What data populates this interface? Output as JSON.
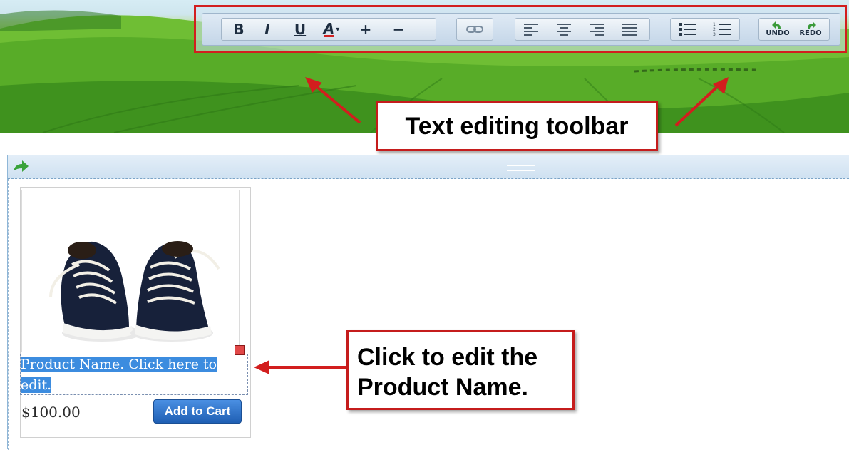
{
  "toolbar": {
    "bold": "B",
    "italic": "I",
    "underline": "U",
    "font_color": "A",
    "font_color_caret": "▾",
    "increase": "+",
    "decrease": "−",
    "undo": "UNDO",
    "redo": "REDO"
  },
  "callouts": {
    "toolbar": "Text editing toolbar",
    "product_line1": "Click to edit the",
    "product_line2": "Product Name."
  },
  "product": {
    "name": "Product Name. Click here to edit.",
    "price": "$100.00",
    "add_to_cart": "Add to Cart"
  },
  "colors": {
    "callout_border": "#c51c1c",
    "selection": "#3c8cdf",
    "button": "#2a6fca"
  }
}
